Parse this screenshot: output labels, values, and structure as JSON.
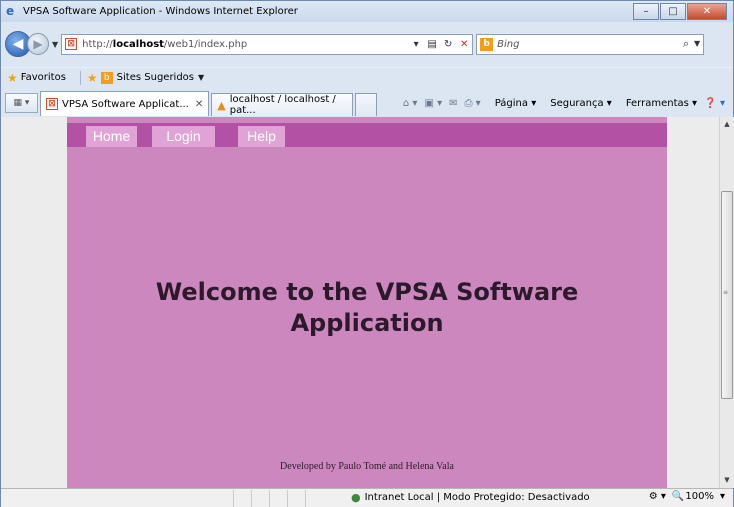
{
  "window": {
    "title": "VPSA Software Application - Windows Internet Explorer",
    "minimize_glyph": "–",
    "maximize_glyph": "□",
    "close_glyph": "✕"
  },
  "address_bar": {
    "url_prefix": "http://",
    "url_host": "localhost",
    "url_path": "/web1/index.php"
  },
  "search": {
    "placeholder": "Bing",
    "provider_icon": "bing-icon"
  },
  "favorites_bar": {
    "favorites_label": "Favoritos",
    "suggested_label": "Sites Sugeridos"
  },
  "tabs": [
    {
      "label": "VPSA Software Applicat...",
      "icon": "site-favicon",
      "active": true
    },
    {
      "label": "localhost / localhost / pat...",
      "icon": "phpmyadmin-icon",
      "active": false
    }
  ],
  "command_bar": {
    "page_label": "Página",
    "safety_label": "Segurança",
    "tools_label": "Ferramentas"
  },
  "site": {
    "nav": [
      "Home",
      "Login",
      "Help"
    ],
    "heading_line1": "Welcome to the VPSA Software",
    "heading_line2": "Application",
    "footer": "Developed by Paulo Tomé and Helena Vala",
    "colors": {
      "page_bg": "#cc88be",
      "nav_bar": "#b352a5",
      "nav_item": "#dfa3d6",
      "heading_text": "#2c1a2c"
    }
  },
  "status_bar": {
    "zone_text": "Intranet Local | Modo Protegido: Desactivado",
    "zoom": "100%"
  }
}
